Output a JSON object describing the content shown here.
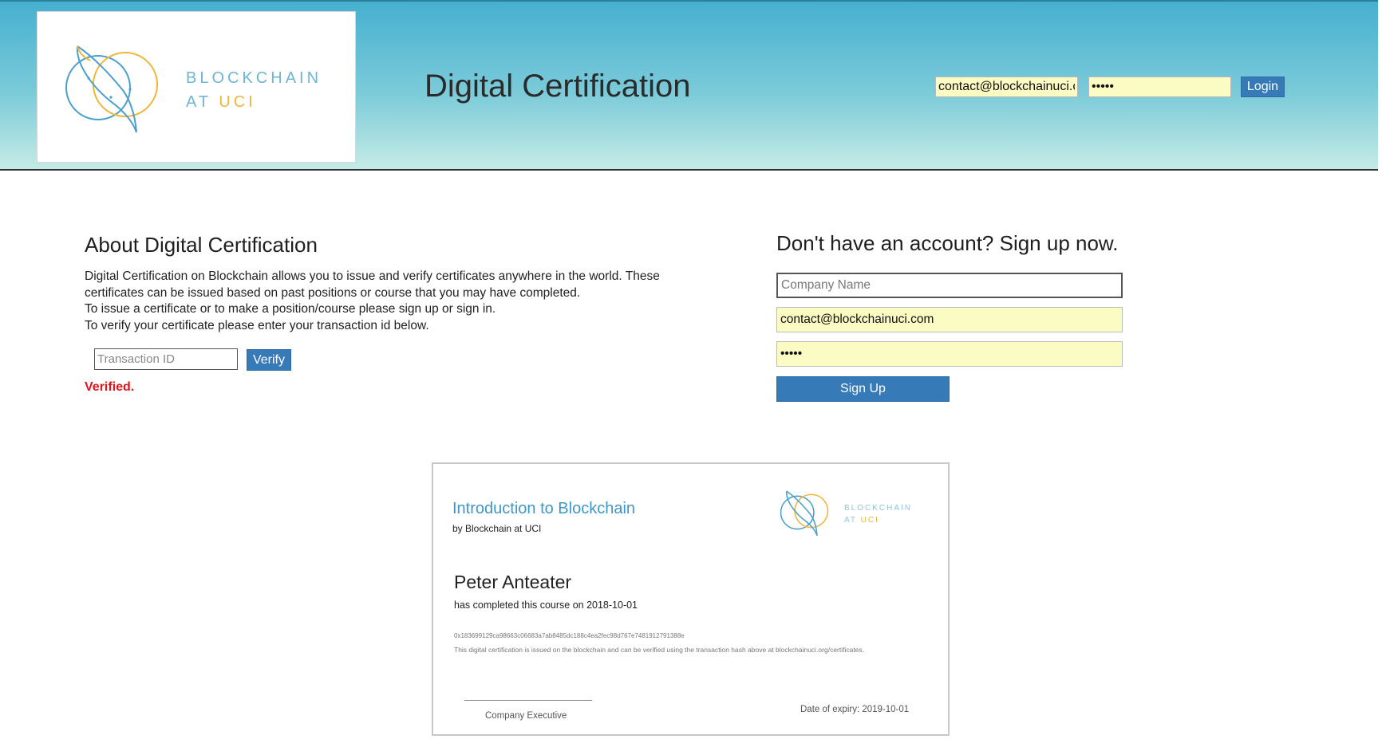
{
  "header": {
    "logo": {
      "line1": "BLOCKCHAIN",
      "line2_at": "AT",
      "line2_uci": "UCI"
    },
    "title": "Digital Certification",
    "login": {
      "email_value": "contact@blockchainuci.com",
      "password_value": "•••••",
      "button_label": "Login"
    }
  },
  "about": {
    "heading": "About Digital Certification",
    "lines": [
      "Digital Certification on Blockchain allows you to issue and verify certificates anywhere in the world. These certificates can be issued based on past positions or course that you may have completed.",
      "To issue a certificate or to make a position/course please sign up or sign in.",
      "To verify your certificate please enter your transaction id below."
    ],
    "transaction_placeholder": "Transaction ID",
    "verify_label": "Verify",
    "status": "Verified."
  },
  "signup": {
    "heading": "Don't have an account? Sign up now.",
    "company_placeholder": "Company Name",
    "email_value": "contact@blockchainuci.com",
    "password_value": "•••••",
    "button_label": "Sign Up"
  },
  "certificate": {
    "course": "Introduction to Blockchain",
    "issuer": "by Blockchain at UCI",
    "logo": {
      "line1": "BLOCKCHAIN",
      "line2_at": "AT",
      "line2_uci": "UCI"
    },
    "recipient": "Peter Anteater",
    "completed_text": "has completed this course on 2018-10-01",
    "hash": "0x183699129ca98663c06683a7ab8485dc188c4ea2fec98d767e7481912791388e",
    "note": "This digital certification is issued on the blockchain and can be verified using the transaction hash above at blockchainuci.org/certificates.",
    "signature_label": "Company Executive",
    "expiry": "Date of expiry: 2019-10-01"
  },
  "colors": {
    "accent_button": "#377ab8",
    "status_verified": "#e0151c",
    "autofill_yellow": "#fbfbc4",
    "logo_blue": "#6fb5d4",
    "logo_gold": "#f0b63a"
  },
  "icons": [
    "blockchain-uci-logo"
  ]
}
